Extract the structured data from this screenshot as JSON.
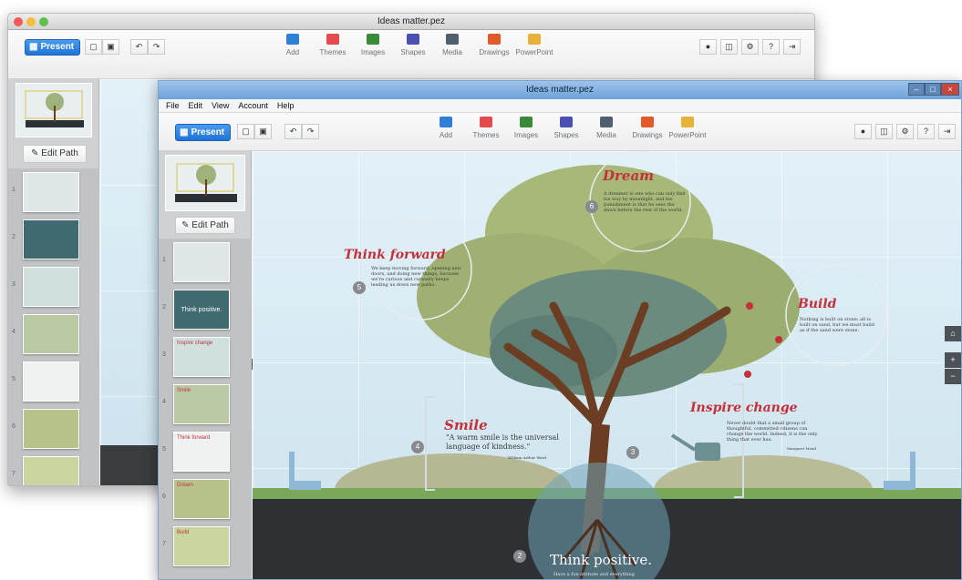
{
  "app": {
    "title": "Ideas matter.pez"
  },
  "colors": {
    "present": "#1f73d8",
    "accent_red": "#c4303a",
    "tree_green": "#a7b673",
    "trunk": "#6b3e24"
  },
  "mac_window": {
    "title": "Ideas matter.pez",
    "present_label": "Present",
    "edit_path_label": "Edit Path",
    "tools": [
      "Add",
      "Themes",
      "Images",
      "Shapes",
      "Media",
      "Drawings",
      "PowerPoint"
    ],
    "slide_numbers": [
      "1",
      "2",
      "3",
      "4",
      "5",
      "6",
      "7"
    ]
  },
  "win_window": {
    "title": "Ideas matter.pez",
    "menu": [
      "File",
      "Edit",
      "View",
      "Account",
      "Help"
    ],
    "present_label": "Present",
    "edit_path_label": "Edit Path",
    "tools": [
      {
        "label": "Add",
        "icon": "plus-icon",
        "color": "#2f7fd6"
      },
      {
        "label": "Themes",
        "icon": "themes-icon",
        "color": "#e24c4c"
      },
      {
        "label": "Images",
        "icon": "image-icon",
        "color": "#3a8a3a"
      },
      {
        "label": "Shapes",
        "icon": "shapes-icon",
        "color": "#4a4fb0"
      },
      {
        "label": "Media",
        "icon": "media-icon",
        "color": "#4f5f6e"
      },
      {
        "label": "Drawings",
        "icon": "drawings-icon",
        "color": "#e05a2a"
      },
      {
        "label": "PowerPoint",
        "icon": "powerpoint-icon",
        "color": "#e8b23a"
      }
    ],
    "slide_numbers": [
      "1",
      "2",
      "3",
      "4",
      "5",
      "6",
      "7"
    ],
    "thumb_texts": {
      "t2": "Think positive.",
      "t5": "Think forward",
      "t6": "Dream",
      "t7": "Build",
      "t3": "Inspire change",
      "t4": "Smile"
    }
  },
  "canvas": {
    "dream": {
      "title": "Dream",
      "num": "6",
      "text": "A dreamer is one who can only find his way by moonlight, and his punishment is that he sees the dawn before the rest of the world."
    },
    "think_forward": {
      "title": "Think forward",
      "num": "5",
      "text": "We keep moving forward, opening new doors, and doing new things, because we're curious and curiosity keeps leading us down new paths."
    },
    "build": {
      "title": "Build",
      "text": "Nothing is built on stone; all is built on sand, but we must build as if the sand were stone."
    },
    "smile": {
      "title": "Smile",
      "num": "4",
      "quote": "\"A warm smile is the universal language of kindness.\"",
      "author": "William Arthur Ward"
    },
    "inspire": {
      "title": "Inspire change",
      "num": "3",
      "text": "Never doubt that a small group of thoughtful, committed citizens can change the world. Indeed, it is the only thing that ever has.",
      "author": "Margaret Mead"
    },
    "positive": {
      "title": "Think positive.",
      "num": "2",
      "sub": "Have a fun attitude and everything"
    }
  }
}
